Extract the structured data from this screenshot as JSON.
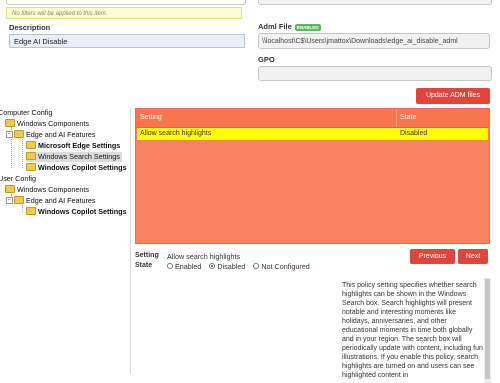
{
  "filter_note": "No filters will be applied to this item.",
  "description": {
    "label": "Description",
    "value": "Edge AI Disable"
  },
  "adml": {
    "label": "Adml File",
    "badge": "ENABLED",
    "value": "\\\\localhost\\C$\\Users\\jmattox\\Downloads\\edge_ai_disable_adml"
  },
  "gpo": {
    "label": "GPO",
    "value": ""
  },
  "update_button": "Update ADM files",
  "tree": {
    "computer_config": "Computer Config",
    "cc_windows_components": "Windows Components",
    "cc_edge_ai": "Edge and AI Features",
    "cc_edge_settings": "Microsoft Edge Settings",
    "cc_search_settings": "Windows Search Settings",
    "cc_copilot_settings": "Windows Copilot Settings",
    "user_config": "User Config",
    "uc_windows_components": "Windows Components",
    "uc_edge_ai": "Edge and AI Features",
    "uc_copilot_settings": "Windows Copilot Settings"
  },
  "table": {
    "headers": {
      "setting": "Setting",
      "state": "State"
    },
    "rows": [
      {
        "setting": "Allow search highlights",
        "state": "Disabled"
      }
    ]
  },
  "detail": {
    "setting_label": "Setting",
    "setting_value": "Allow search highlights",
    "state_label": "State",
    "options": [
      "Enabled",
      "Disabled",
      "Not Configured"
    ],
    "selected": "Disabled"
  },
  "buttons": {
    "previous": "Previous",
    "next": "Next"
  },
  "help_text": "This policy setting specifies whether search highlights can be shown in the Windows Search box. Search highlights will present notable and interesting moments like holidays, anniversaries, and other educational moments in time both globally and in your region. The search box will periodically update with content, including fun illustrations. If you enable this policy, search highlights are turned on and users can see highlighted content in",
  "colors": {
    "accent": "#e0443b",
    "table_bg": "#f98264",
    "highlight": "#ffff00"
  }
}
